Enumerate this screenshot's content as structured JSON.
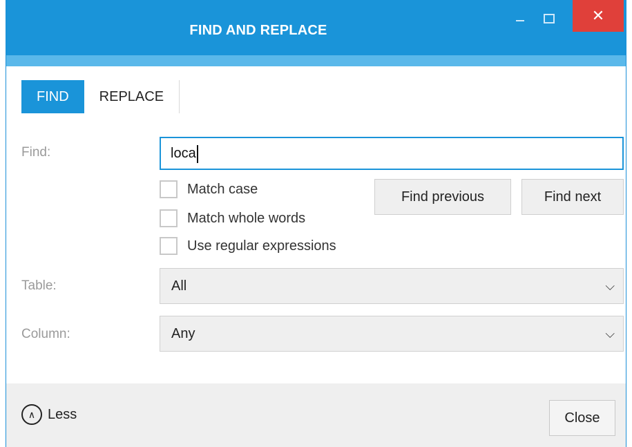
{
  "window": {
    "title": "FIND AND REPLACE",
    "minimize_glyph": "",
    "maximize_glyph": "",
    "close_glyph": "✕"
  },
  "tabs": [
    {
      "label": "FIND",
      "active": true
    },
    {
      "label": "REPLACE",
      "active": false
    }
  ],
  "find": {
    "label": "Find:",
    "value": "loca"
  },
  "options": [
    {
      "label": "Match case",
      "checked": false
    },
    {
      "label": "Match whole words",
      "checked": false
    },
    {
      "label": "Use regular expressions",
      "checked": false
    }
  ],
  "buttons": {
    "find_previous": "Find previous",
    "find_next": "Find next"
  },
  "table": {
    "label": "Table:",
    "value": "All"
  },
  "column": {
    "label": "Column:",
    "value": "Any"
  },
  "footer": {
    "less_label": "Less",
    "close_label": "Close"
  },
  "colors": {
    "accent": "#1a94d9",
    "close_button": "#e0403a"
  },
  "icons": {
    "minimize": "minimize-icon",
    "maximize": "maximize-icon",
    "close": "close-icon",
    "chevron": "chevron-down-icon",
    "collapse": "chevron-up-circle-icon"
  }
}
